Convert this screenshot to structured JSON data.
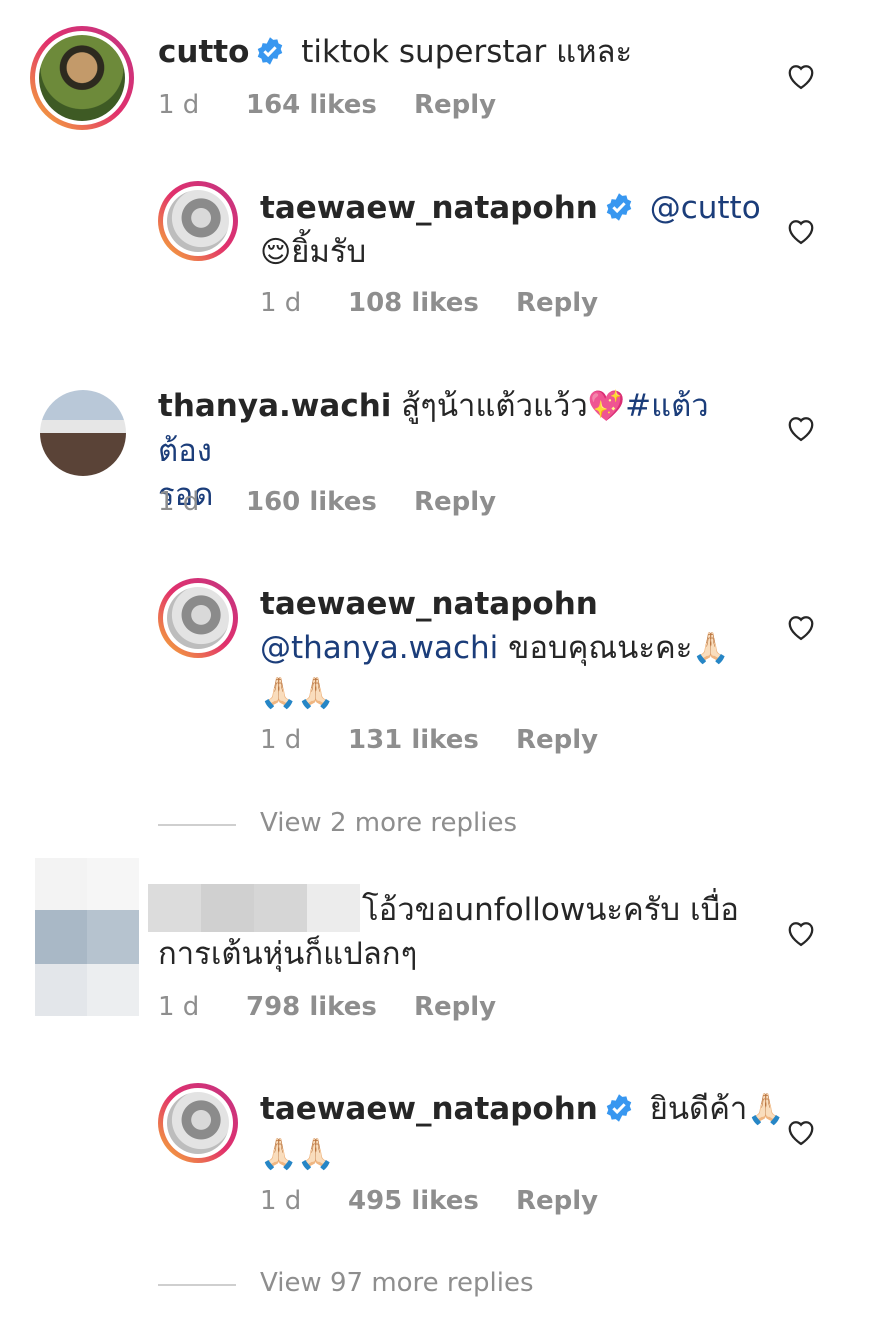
{
  "comments": [
    {
      "username": "cutto",
      "verified": true,
      "text": "tiktok superstar แหละ",
      "time": "1 d",
      "likes": "164 likes",
      "reply": "Reply"
    },
    {
      "username": "taewaew_natapohn",
      "verified": true,
      "mention": "@cutto",
      "text_line2": "ยิ้มรับ",
      "emoji": "😌",
      "time": "1 d",
      "likes": "108 likes",
      "reply": "Reply"
    },
    {
      "username": "thanya.wachi",
      "verified": false,
      "text": "สู้ๆน้าแต้วแว้ว",
      "emoji": "💖",
      "hashtag": "#แต้วต้อง",
      "hashtag_line2": "รอด",
      "time": "1 d",
      "likes": "160 likes",
      "reply": "Reply"
    },
    {
      "username": "taewaew_natapohn",
      "verified": false,
      "mention": "@thanya.wachi",
      "text": "ขอบคุณนะคะ",
      "emoji": "🙏🏻",
      "emoji_line3": "🙏🏻🙏🏻",
      "time": "1 d",
      "likes": "131 likes",
      "reply": "Reply"
    },
    {
      "username": "",
      "text": "โอ้วขอunfollowนะครับ เบื่อ",
      "text_line2": "การเต้นหุ่นก็แปลกๆ",
      "time": "1 d",
      "likes": "798 likes",
      "reply": "Reply"
    },
    {
      "username": "taewaew_natapohn",
      "verified": true,
      "text": "ยินดีค้า",
      "emoji": "🙏🏻",
      "emoji_line2": "🙏🏻🙏🏻",
      "time": "1 d",
      "likes": "495 likes",
      "reply": "Reply"
    }
  ],
  "view_more_1": "View 2 more replies",
  "view_more_2": "View 97 more replies",
  "icons": {
    "like": "heart-outline-icon",
    "verified": "verified-badge-icon"
  },
  "colors": {
    "link": "#1b3d7a",
    "muted": "#8e8e8e",
    "verified": "#3897f0"
  }
}
